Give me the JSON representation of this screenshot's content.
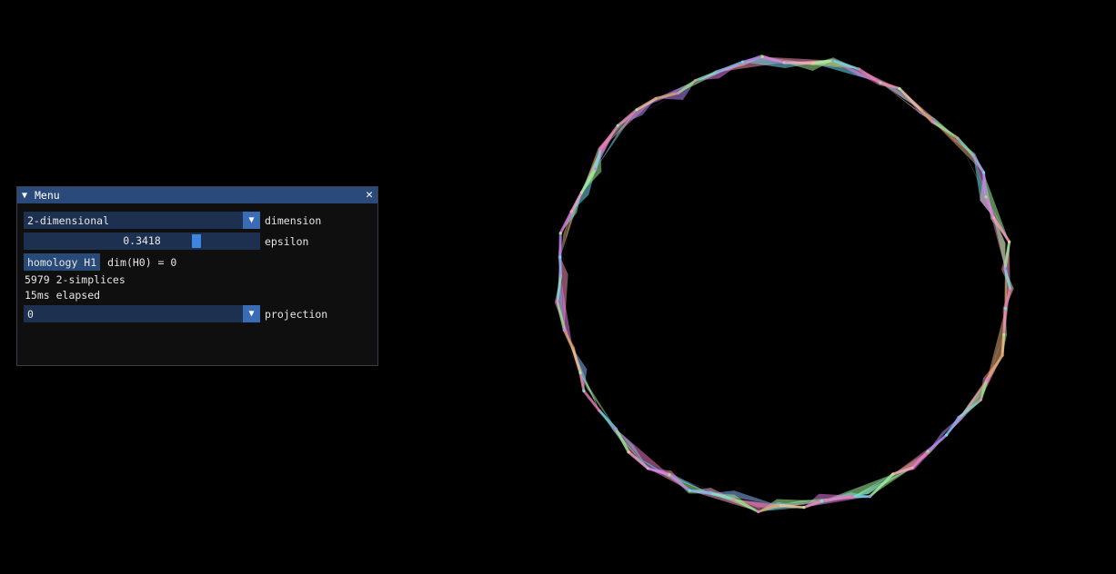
{
  "window": {
    "title": "Menu",
    "collapse_glyph": "▼",
    "close_glyph": "✕"
  },
  "dimension": {
    "value": "2-dimensional",
    "label": "dimension"
  },
  "epsilon": {
    "value_text": "0.3418",
    "fraction": 0.74,
    "label": "epsilon"
  },
  "homology": {
    "button_label": "homology H1",
    "dim_text": "dim(H0) = 0"
  },
  "stats": {
    "simplices": "5979 2-simplices",
    "elapsed": "15ms elapsed"
  },
  "projection": {
    "value": "0",
    "label": "projection"
  },
  "icons": {
    "combo_arrow": "chevron-down-icon",
    "close": "close-icon",
    "collapse": "collapse-triangle-icon"
  },
  "colors": {
    "background": "#000000",
    "title_bar": "#294a7a",
    "frame": "#1d3050",
    "accent": "#3d85e0",
    "button": "#284a78"
  },
  "render": {
    "complex_colors": [
      "#e879b9",
      "#f08ab0",
      "#f2c394",
      "#d9a86b",
      "#9fe58c",
      "#7fe3c8",
      "#8ab0f2",
      "#b38af2",
      "#e27ae8",
      "#f3a0c8",
      "#a0f0a0",
      "#6fd8e8"
    ]
  }
}
